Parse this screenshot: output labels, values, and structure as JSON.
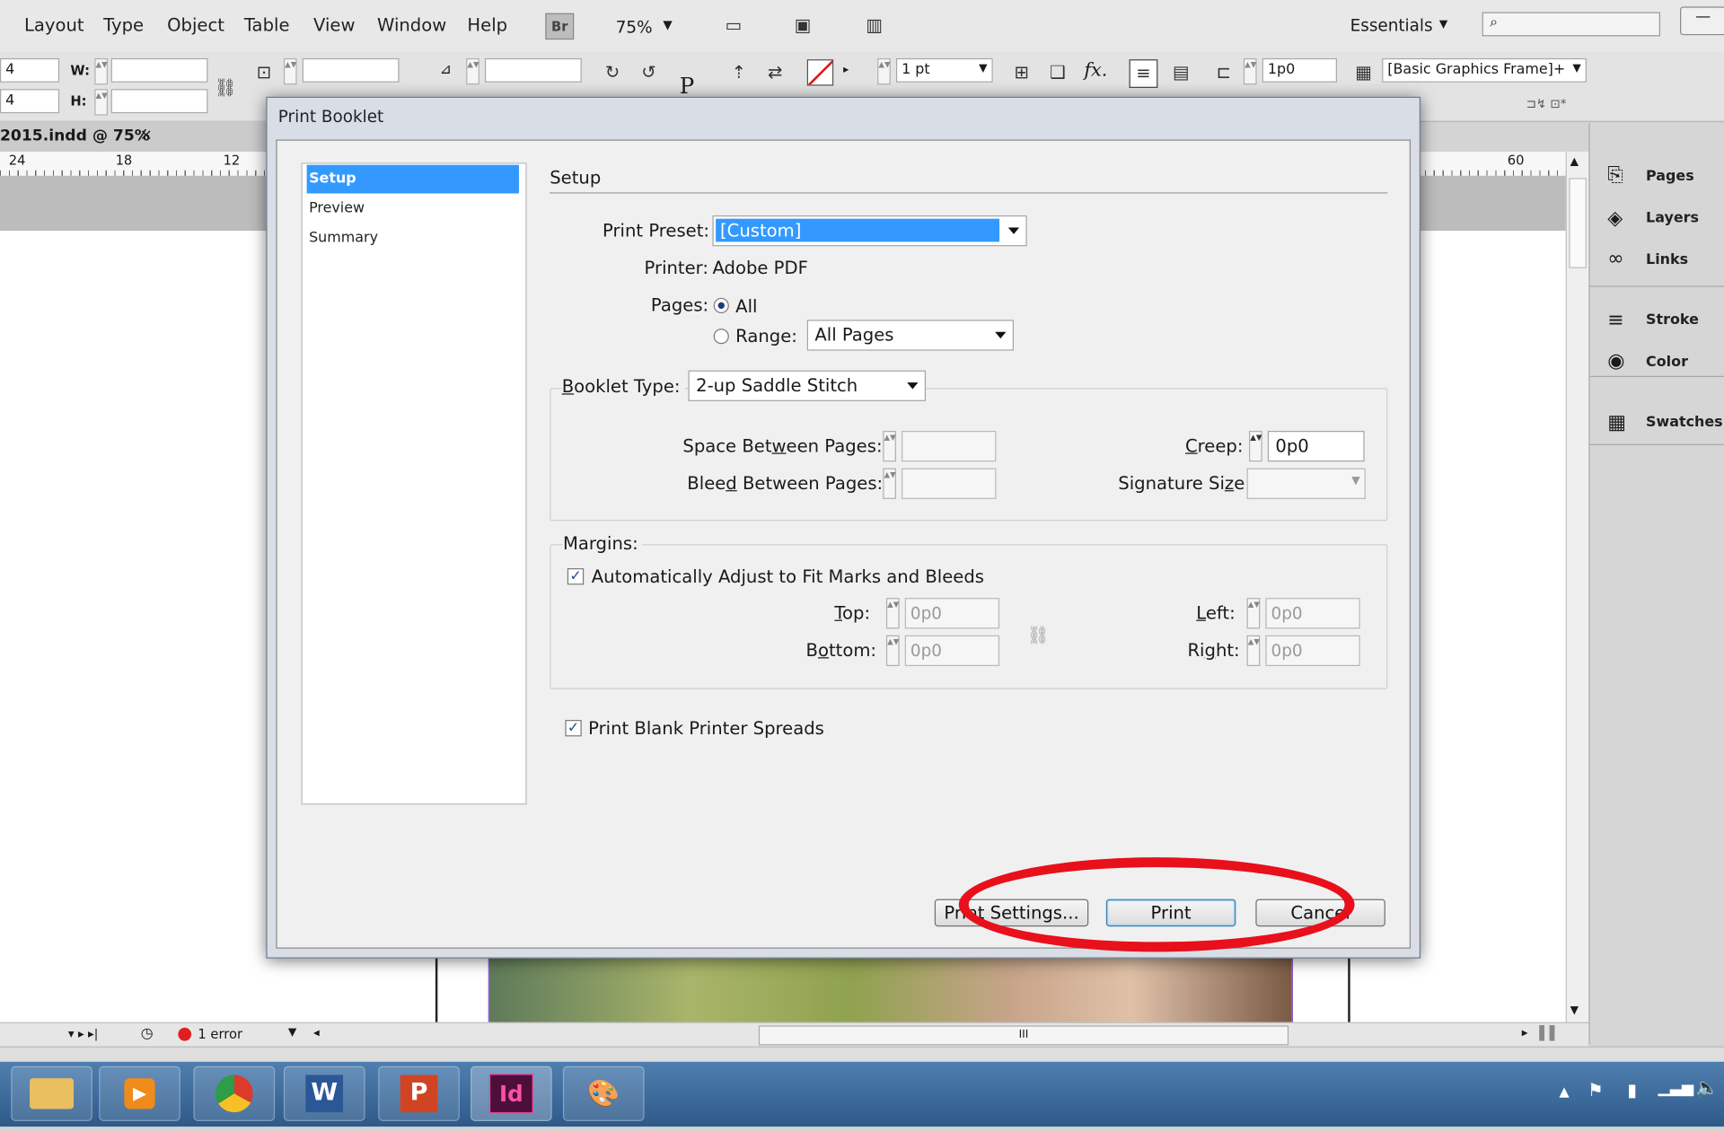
{
  "menu": [
    "Layout",
    "Type",
    "Object",
    "Table",
    "View",
    "Window",
    "Help"
  ],
  "appbar": {
    "br_label": "Br",
    "zoom": "75%",
    "workspace": "Essentials"
  },
  "control": {
    "x_val": "4",
    "y_val": "4",
    "w_label": "W:",
    "h_label": "H:",
    "stroke_weight": "1 pt",
    "frame_size": "1p0",
    "object_style": "[Basic Graphics Frame]+"
  },
  "document_tab": "2015.indd @ 75%",
  "ruler": {
    "t1": "24",
    "t2": "18",
    "t3": "12",
    "t4": "60"
  },
  "panels": [
    "Pages",
    "Layers",
    "Links",
    "Stroke",
    "Color",
    "Swatches"
  ],
  "status": {
    "error": "1 error",
    "scroll_grip": "III"
  },
  "taskbar": {
    "word": "W",
    "ppt": "P",
    "indesign": "Id"
  },
  "dialog": {
    "title": "Print Booklet",
    "nav": [
      "Setup",
      "Preview",
      "Summary"
    ],
    "section_title": "Setup",
    "print_preset_label": "Print Preset:",
    "print_preset_value": "[Custom]",
    "printer_label": "Printer:",
    "printer_value": "Adobe PDF",
    "pages_label": "Pages:",
    "all_label": "All",
    "range_label": "Range:",
    "range_value": "All Pages",
    "booklet_type_label": "Booklet Type:",
    "booklet_type_value": "2-up Saddle Stitch",
    "space_between_label": "Space Between Pages:",
    "bleed_between_label": "Bleed Between Pages:",
    "creep_label": "Creep:",
    "creep_value": "0p0",
    "signature_label": "Signature Size:",
    "margins_label": "Margins:",
    "auto_adjust_label": "Automatically Adjust to Fit Marks and Bleeds",
    "top_label": "Top:",
    "top_value": "0p0",
    "bottom_label": "Bottom:",
    "bottom_value": "0p0",
    "left_label": "Left:",
    "left_value": "0p0",
    "right_label": "Right:",
    "right_value": "0p0",
    "blank_spreads_label": "Print Blank Printer Spreads",
    "print_settings_button": "Print Settings...",
    "print_button": "Print",
    "cancel_button": "Cancel"
  },
  "colors": {
    "selection": "#3399ff",
    "highlight": "#e8101b"
  }
}
